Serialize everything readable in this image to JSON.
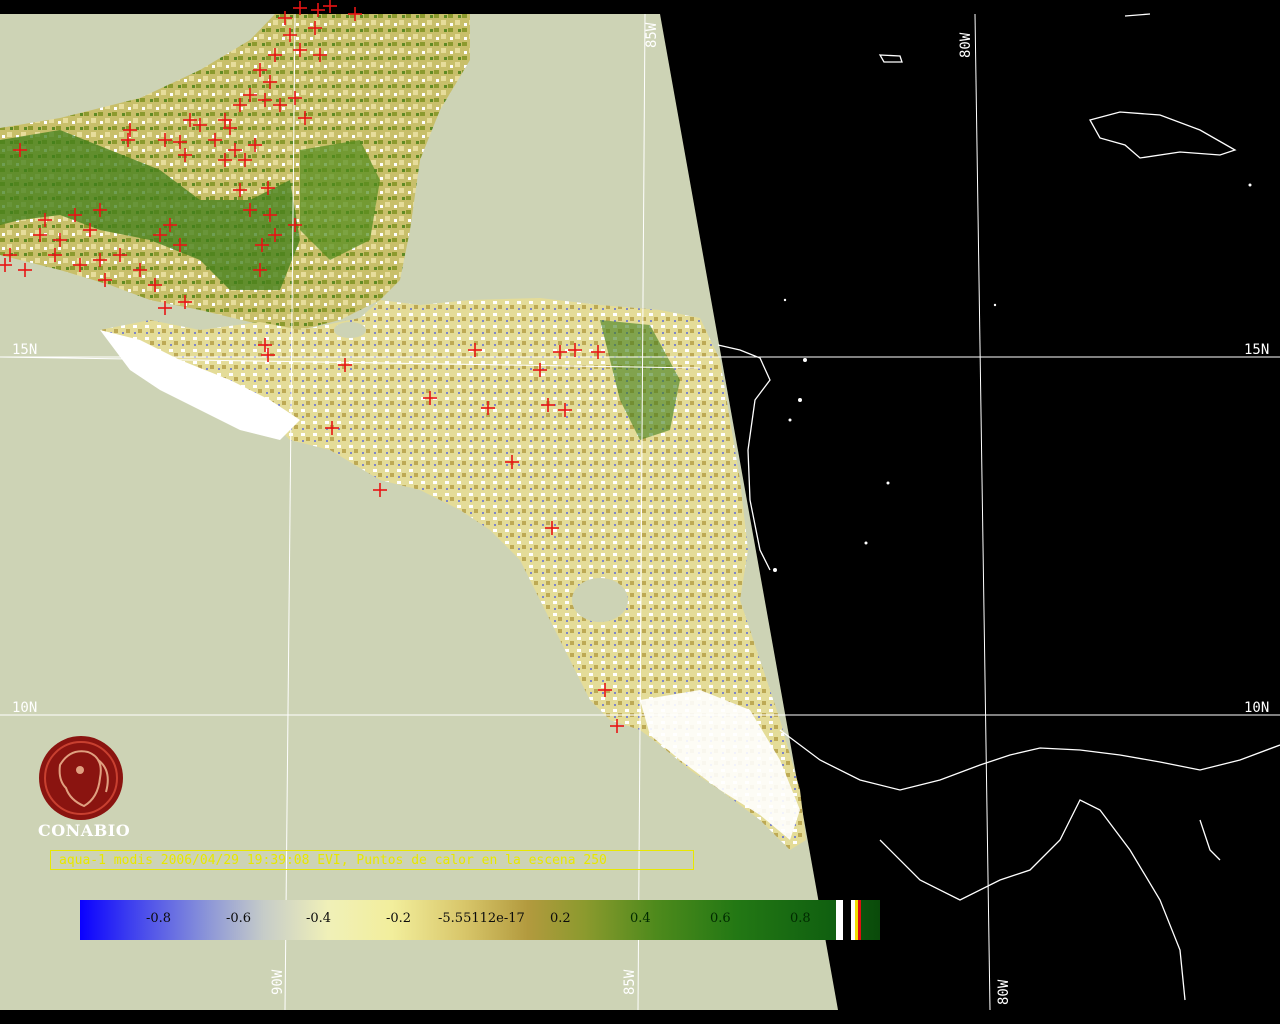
{
  "colors": {
    "ocean": "#cdd3b5",
    "night": "#000000",
    "grid": "#ffffff",
    "fire": "#e81414",
    "caption": "#e8e800",
    "coast": "#ffffff"
  },
  "graticule": {
    "lat_labels_left": [
      "15N",
      "10N"
    ],
    "lat_labels_right": [
      "15N",
      "10N"
    ],
    "lon_labels_top": [
      "85W",
      "80W"
    ],
    "lon_labels_bottom": [
      "90W",
      "85W",
      "80W"
    ]
  },
  "logo": {
    "name": "CONABIO"
  },
  "caption": "aqua-1 modis 2006/04/29 19:39:08 EVI, Puntos de calor en la escena 250",
  "colorbar": {
    "labels": [
      "-0.8",
      "-0.6",
      "-0.4",
      "-0.2",
      "-5.55112e-17",
      "0.2",
      "0.4",
      "0.6",
      "0.8"
    ]
  },
  "icons": {
    "hotspot": "red-cross-marker-icon",
    "logo": "conabio-logo-icon"
  }
}
